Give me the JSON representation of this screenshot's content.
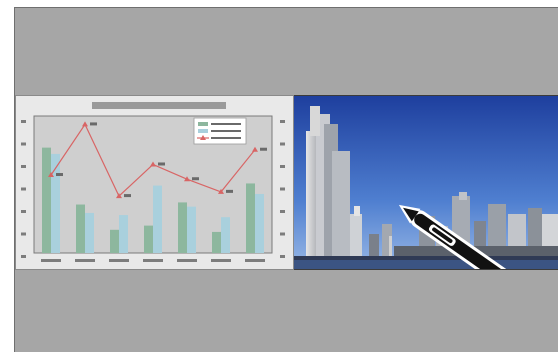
{
  "screen": {
    "background": "#a6a6a6",
    "layout": "split-screen"
  },
  "left_pane": {
    "content": "presentation-chart-slide",
    "background": "#e9e9e9"
  },
  "right_pane": {
    "content": "city-skyline-photo",
    "icon": "interactive-pen-icon"
  },
  "colors": {
    "bar_green": "#8db79e",
    "bar_blue": "#a9d0dd",
    "line_red": "#d86565",
    "sky_top": "#1f45a8",
    "sky_bottom": "#7fa8e0"
  },
  "chart_data": {
    "type": "bar",
    "categories": [
      "",
      "",
      "",
      "",
      "",
      "",
      ""
    ],
    "series": [
      {
        "values": [
          5,
          2.3,
          1.1,
          1.3,
          2.4,
          1.0,
          3.3
        ]
      },
      {
        "values": [
          4.7,
          1.9,
          1.8,
          3.2,
          2.2,
          1.7,
          2.8
        ]
      },
      {
        "values": [
          3.7,
          6.1,
          2.7,
          4.2,
          3.5,
          2.9,
          4.9
        ]
      }
    ],
    "ylim": [
      0,
      6.5
    ],
    "grid": false,
    "legend": "top-right"
  }
}
